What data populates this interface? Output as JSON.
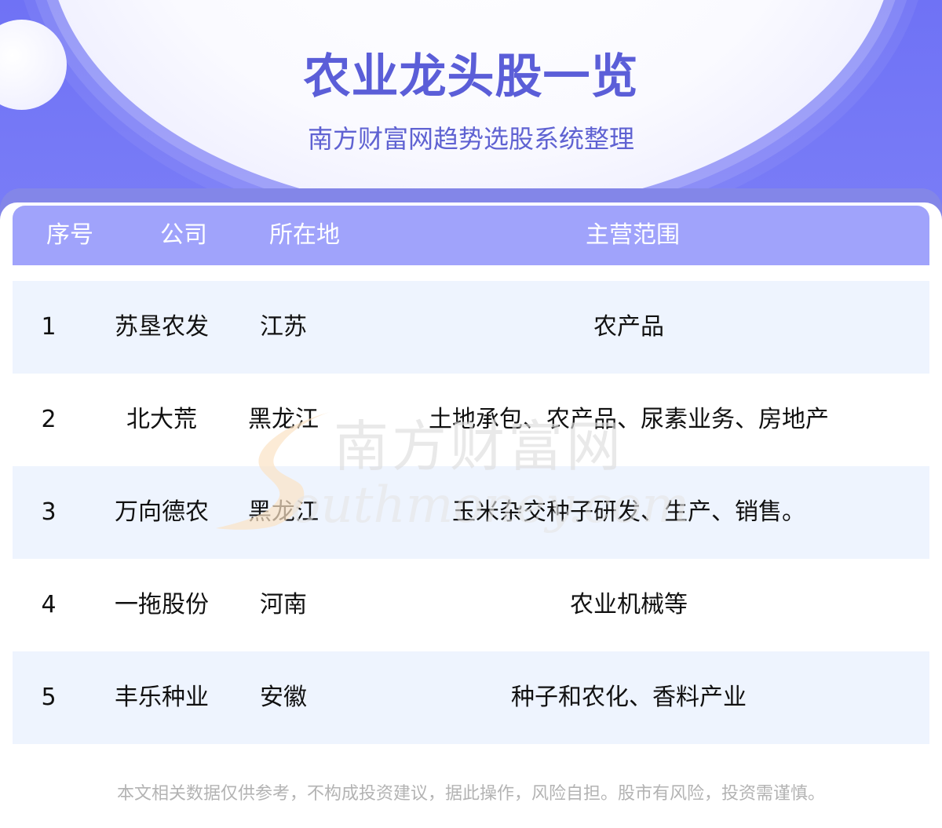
{
  "header": {
    "title": "农业龙头股一览",
    "subtitle": "南方财富网趋势选股系统整理"
  },
  "table": {
    "columns": [
      "序号",
      "公司",
      "所在地",
      "主营范围"
    ],
    "rows": [
      {
        "index": "1",
        "company": "苏垦农发",
        "location": "江苏",
        "business": "农产品"
      },
      {
        "index": "2",
        "company": "北大荒",
        "location": "黑龙江",
        "business": "土地承包、农产品、尿素业务、房地产"
      },
      {
        "index": "3",
        "company": "万向德农",
        "location": "黑龙江",
        "business": "玉米杂交种子研发、生产、销售。"
      },
      {
        "index": "4",
        "company": "一拖股份",
        "location": "河南",
        "business": "农业机械等"
      },
      {
        "index": "5",
        "company": "丰乐种业",
        "location": "安徽",
        "business": "种子和农化、香料产业"
      }
    ]
  },
  "watermark": {
    "cn": "南方财富网",
    "en": "outhmoney.com"
  },
  "footer": {
    "disclaimer": "本文相关数据仅供参考，不构成投资建议，据此操作，风险自担。股市有风险，投资需谨慎。"
  }
}
